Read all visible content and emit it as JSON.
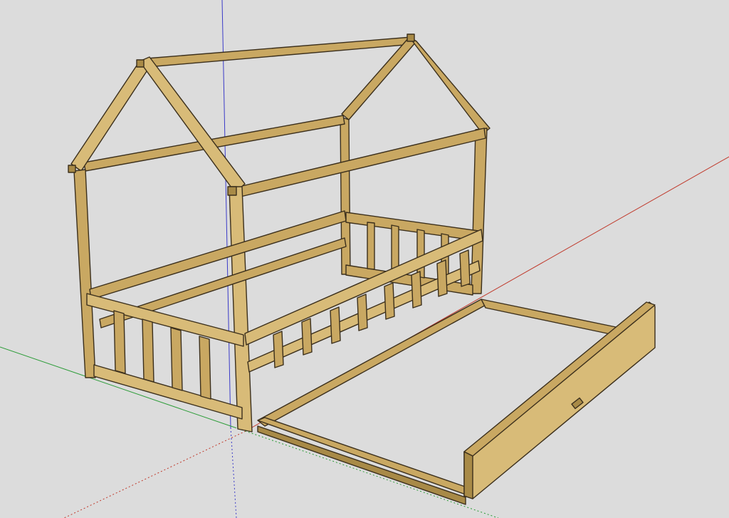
{
  "app": {
    "background_color": "#dcdcdc"
  },
  "scene": {
    "objects": [
      {
        "name": "house-bed-frame"
      },
      {
        "name": "trundle-drawer"
      }
    ],
    "axes": {
      "x_color": "#c0392b",
      "y_color": "#2e9d3a",
      "z_color": "#3a3ac8"
    },
    "material": {
      "wood_color": "#c9a862",
      "wood_edge_color": "#3b2f1c"
    }
  }
}
